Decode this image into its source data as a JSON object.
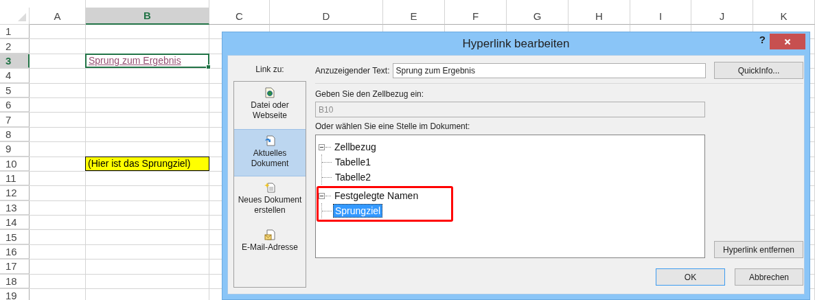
{
  "spreadsheet": {
    "columns": [
      {
        "label": "A",
        "selected": false
      },
      {
        "label": "B",
        "selected": true
      },
      {
        "label": "C",
        "selected": false
      },
      {
        "label": "D",
        "selected": false
      },
      {
        "label": "E",
        "selected": false
      },
      {
        "label": "F",
        "selected": false
      },
      {
        "label": "G",
        "selected": false
      },
      {
        "label": "H",
        "selected": false
      },
      {
        "label": "I",
        "selected": false
      },
      {
        "label": "J",
        "selected": false
      },
      {
        "label": "K",
        "selected": false
      }
    ],
    "rows": [
      {
        "label": "1",
        "selected": false
      },
      {
        "label": "2",
        "selected": false
      },
      {
        "label": "3",
        "selected": true,
        "column_b": {
          "text": "Sprung zum Ergebnis",
          "kind": "link",
          "active": true
        }
      },
      {
        "label": "4",
        "selected": false
      },
      {
        "label": "5",
        "selected": false
      },
      {
        "label": "6",
        "selected": false
      },
      {
        "label": "7",
        "selected": false
      },
      {
        "label": "8",
        "selected": false
      },
      {
        "label": "9",
        "selected": false
      },
      {
        "label": "10",
        "selected": false,
        "column_b": {
          "text": "(Hier ist das Sprungziel)",
          "kind": "highlight",
          "active": false
        }
      },
      {
        "label": "11",
        "selected": false
      },
      {
        "label": "12",
        "selected": false
      },
      {
        "label": "13",
        "selected": false
      },
      {
        "label": "14",
        "selected": false
      },
      {
        "label": "15",
        "selected": false
      },
      {
        "label": "16",
        "selected": false
      },
      {
        "label": "17",
        "selected": false
      },
      {
        "label": "18",
        "selected": false
      },
      {
        "label": "19",
        "selected": false
      }
    ]
  },
  "dialog": {
    "title": "Hyperlink bearbeiten",
    "help": "?",
    "link_to": {
      "label": "Link zu:",
      "items": [
        {
          "label": "Datei oder Webseite",
          "kind": "file",
          "selected": false
        },
        {
          "label": "Aktuelles Dokument",
          "kind": "current",
          "selected": true
        },
        {
          "label": "Neues Dokument erstellen",
          "kind": "new",
          "selected": false
        },
        {
          "label": "E-Mail-Adresse",
          "kind": "mail",
          "selected": false
        }
      ]
    },
    "display_text": {
      "label": "Anzuzeigender Text:",
      "value": "Sprung zum Ergebnis"
    },
    "quickinfo_button": "QuickInfo...",
    "cell_reference": {
      "label": "Geben Sie den Zellbezug ein:",
      "value": "B10",
      "disabled": true
    },
    "location": {
      "label": "Oder wählen Sie eine Stelle im Dokument:",
      "tree": [
        {
          "label": "Zellbezug",
          "expanded": true,
          "selected": false,
          "marked": false,
          "children": [
            {
              "label": "Tabelle1",
              "selected": false
            },
            {
              "label": "Tabelle2",
              "selected": false
            }
          ]
        },
        {
          "label": "Festgelegte Namen",
          "expanded": true,
          "selected": false,
          "marked": true,
          "children": [
            {
              "label": "Sprungziel",
              "selected": true
            }
          ]
        }
      ]
    },
    "remove_button": "Hyperlink entfernen",
    "buttons": [
      {
        "label": "OK",
        "default": true
      },
      {
        "label": "Abbrechen",
        "default": false
      }
    ]
  }
}
